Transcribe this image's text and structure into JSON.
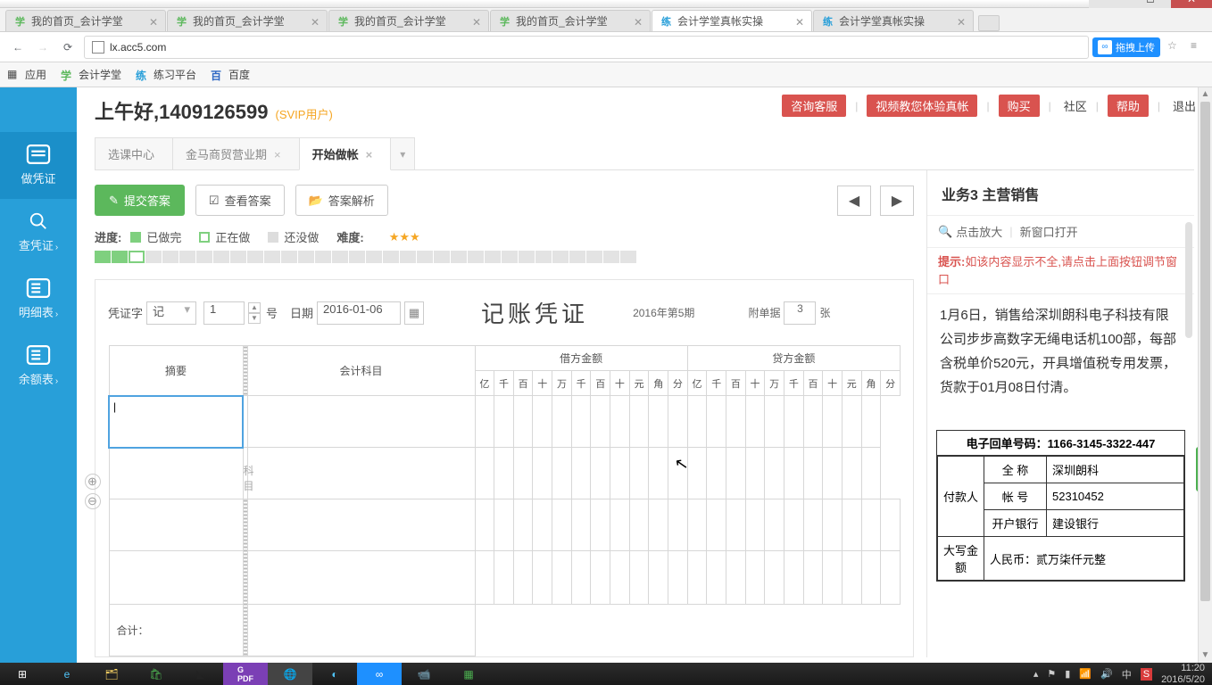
{
  "window": {
    "min": "─",
    "max": "□",
    "close": "✕"
  },
  "browser_tabs": [
    {
      "fav": "学",
      "favColor": "#5cb85c",
      "text": "我的首页_会计学堂"
    },
    {
      "fav": "学",
      "favColor": "#5cb85c",
      "text": "我的首页_会计学堂"
    },
    {
      "fav": "学",
      "favColor": "#5cb85c",
      "text": "我的首页_会计学堂"
    },
    {
      "fav": "学",
      "favColor": "#5cb85c",
      "text": "我的首页_会计学堂"
    },
    {
      "fav": "练",
      "favColor": "#289fd9",
      "text": "会计学堂真帐实操",
      "active": true
    },
    {
      "fav": "练",
      "favColor": "#289fd9",
      "text": "会计学堂真帐实操"
    }
  ],
  "nav": {
    "back": "←",
    "fwd": "→",
    "reload": "⟳"
  },
  "url": "lx.acc5.com",
  "upload": {
    "icon": "∞",
    "text": "拖拽上传"
  },
  "bookmarks": {
    "apps": "应用",
    "items": [
      {
        "ico": "学",
        "color": "#5cb85c",
        "txt": "会计学堂"
      },
      {
        "ico": "练",
        "color": "#289fd9",
        "txt": "练习平台"
      },
      {
        "ico": "百",
        "color": "#2d67c3",
        "txt": "百度"
      }
    ]
  },
  "sidebar": {
    "items": [
      {
        "label": "做凭证",
        "chev": ""
      },
      {
        "label": "查凭证",
        "chev": "›"
      },
      {
        "label": "明细表",
        "chev": "›"
      },
      {
        "label": "余额表",
        "chev": "›"
      }
    ]
  },
  "greeting": {
    "hello": "上午好,",
    "user": "1409126599",
    "svip": "(SVIP用户)"
  },
  "top_links": {
    "consult": "咨询客服",
    "video": "视频教您体验真帐",
    "buy": "购买",
    "community": "社区",
    "help": "帮助",
    "logout": "退出"
  },
  "page_tabs": [
    {
      "label": "选课中心",
      "closable": false
    },
    {
      "label": "金马商贸营业期",
      "closable": true
    },
    {
      "label": "开始做帐",
      "closable": true,
      "active": true
    }
  ],
  "toolbar": {
    "submit": "提交答案",
    "view": "查看答案",
    "analyze": "答案解析",
    "prev": "◀",
    "next": "▶"
  },
  "legend": {
    "progress": "进度:",
    "done": "已做完",
    "doing": "正在做",
    "todo": "还没做",
    "difficulty": "难度:",
    "stars": "★★★"
  },
  "progress_cells": [
    "done",
    "done",
    "doing",
    "todo",
    "todo",
    "todo",
    "todo",
    "todo",
    "todo",
    "todo",
    "todo",
    "todo",
    "todo",
    "todo",
    "todo",
    "todo",
    "todo",
    "todo",
    "todo",
    "todo",
    "todo",
    "todo",
    "todo",
    "todo",
    "todo",
    "todo",
    "todo",
    "todo",
    "todo",
    "todo",
    "todo",
    "todo"
  ],
  "voucher": {
    "char_lbl": "凭证字",
    "char_val": "记",
    "num_val": "1",
    "num_suffix": "号",
    "date_lbl": "日期",
    "date_val": "2016-01-06",
    "title": "记账凭证",
    "period": "2016年第5期",
    "attach_lbl": "附单据",
    "attach_val": "3",
    "attach_suffix": "张",
    "headers": {
      "summary": "摘要",
      "subject": "会计科目",
      "debit": "借方金额",
      "credit": "贷方金额"
    },
    "digits": [
      "亿",
      "千",
      "百",
      "十",
      "万",
      "千",
      "百",
      "十",
      "元",
      "角",
      "分"
    ],
    "subject_ph": "科目",
    "total": "合计："
  },
  "right": {
    "title": "业务3 主营销售",
    "zoom": "点击放大",
    "newwin": "新窗口打开",
    "hint_lbl": "提示:",
    "hint": "如该内容显示不全,请点击上面按钮调节窗口",
    "body": "1月6日，销售给深圳朗科电子科技有限公司步步高数字无绳电话机100部，每部含税单价520元，开具增值税专用发票，货款于01月08日付清。",
    "receipt": {
      "code_lbl": "电子回单号码：",
      "code": "1166-3145-3322-447",
      "payer": "付款人",
      "fullname_lbl": "全 称",
      "fullname": "深圳朗科",
      "acct_lbl": "帐 号",
      "acct": "52310452",
      "bank_lbl": "开户银行",
      "bank": "建设银行",
      "amount_lbl": "大写金额",
      "amount": "人民币：贰万柒仟元整"
    }
  },
  "taskbar": {
    "time": "11:20",
    "date": "2016/5/20"
  }
}
